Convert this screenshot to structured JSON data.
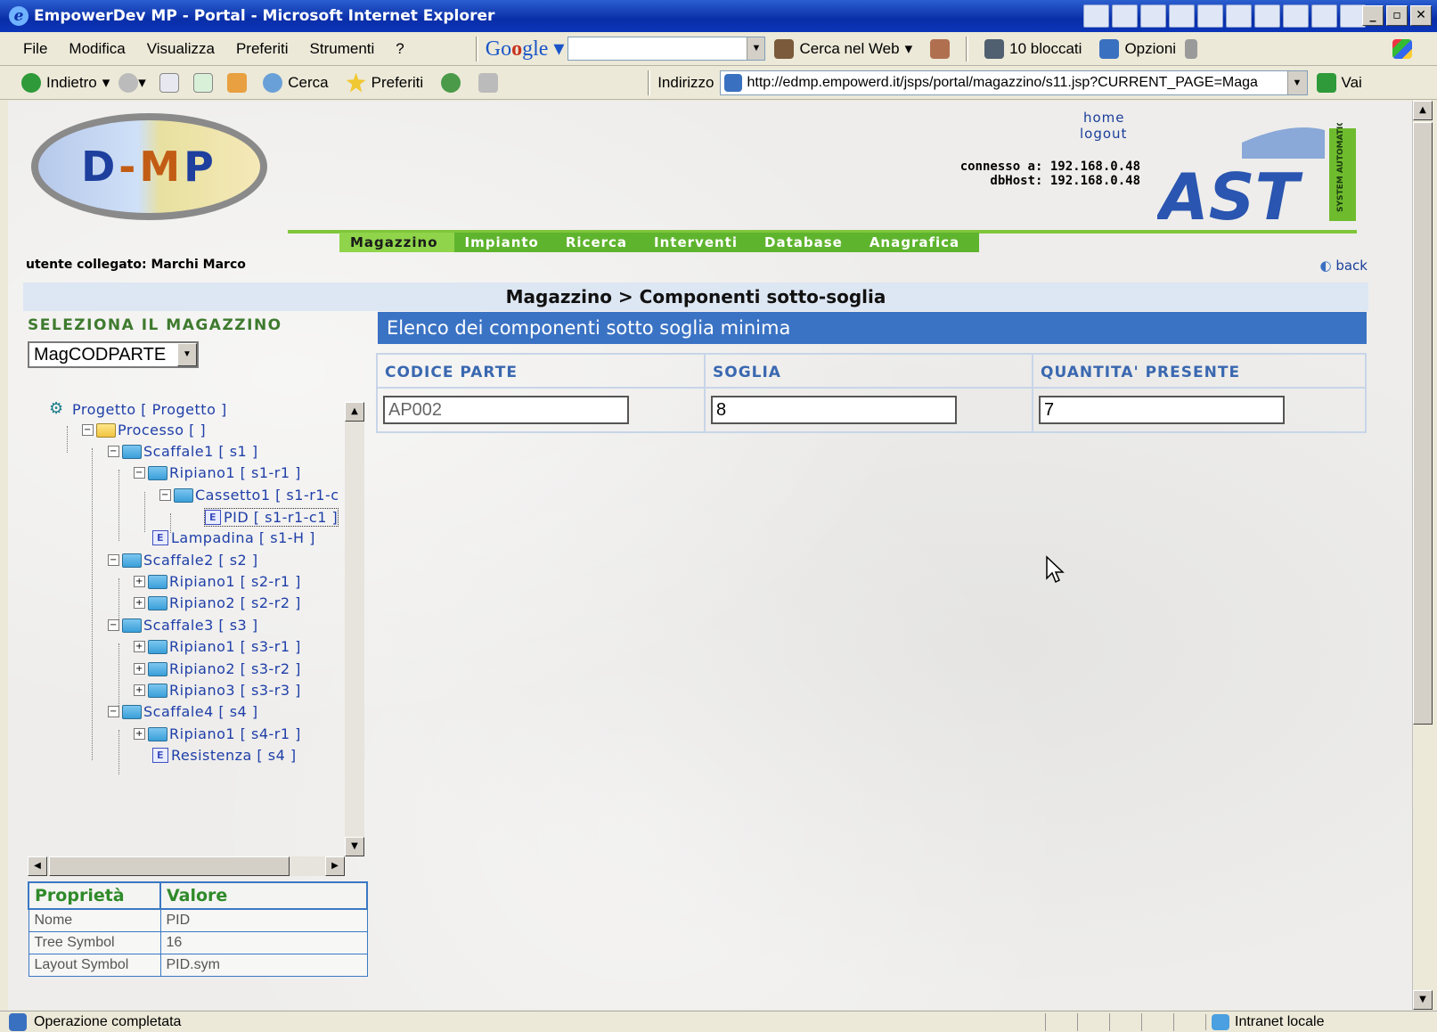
{
  "window": {
    "title": "EmpowerDev MP - Portal - Microsoft Internet Explorer"
  },
  "menubar": {
    "items": [
      "File",
      "Modifica",
      "Visualizza",
      "Preferiti",
      "Strumenti",
      "?"
    ],
    "search_web": "Cerca nel Web",
    "blocked": "10 bloccati",
    "options": "Opzioni"
  },
  "navbar": {
    "back": "Indietro",
    "search": "Cerca",
    "favorites": "Preferiti",
    "address_label": "Indirizzo",
    "url": "http://edmp.empowerd.it/jsps/portal/magazzino/s11.jsp?CURRENT_PAGE=Maga",
    "go": "Vai"
  },
  "header": {
    "logo_d": "D",
    "logo_dash": "-",
    "logo_m": "M",
    "logo_p": "P",
    "home": "home",
    "logout": "logout",
    "connected_to": "connesso a: 192.168.0.48",
    "db_host": "dbHost: 192.168.0.48",
    "brand": "AST",
    "brand_side": "SYSTEM AUTOMATION"
  },
  "mainnav": [
    "Magazzino",
    "Impianto",
    "Ricerca",
    "Interventi",
    "Database",
    "Anagrafica"
  ],
  "user": "utente collegato: Marchi Marco",
  "back": "back",
  "breadcrumb": "Magazzino > Componenti sotto-soglia",
  "sidebar": {
    "select_heading": "SELEZIONA IL MAGAZZINO",
    "selected_magazzino": "MagCODPARTE",
    "tree": [
      {
        "label": "Progetto [ Progetto ]"
      },
      {
        "label": "Processo [ ]"
      },
      {
        "label": "Scaffale1 [ s1 ]"
      },
      {
        "label": "Ripiano1 [ s1-r1 ]"
      },
      {
        "label": "Cassetto1 [ s1-r1-c"
      },
      {
        "label": "PID [ s1-r1-c1 ]"
      },
      {
        "label": "Lampadina [ s1-H ]"
      },
      {
        "label": "Scaffale2 [ s2 ]"
      },
      {
        "label": "Ripiano1 [ s2-r1 ]"
      },
      {
        "label": "Ripiano2 [ s2-r2 ]"
      },
      {
        "label": "Scaffale3 [ s3 ]"
      },
      {
        "label": "Ripiano1 [ s3-r1 ]"
      },
      {
        "label": "Ripiano2 [ s3-r2 ]"
      },
      {
        "label": "Ripiano3 [ s3-r3 ]"
      },
      {
        "label": "Scaffale4 [ s4 ]"
      },
      {
        "label": "Ripiano1 [ s4-r1 ]"
      },
      {
        "label": "Resistenza [ s4 ]"
      }
    ],
    "properties": {
      "headers": [
        "Proprietà",
        "Valore"
      ],
      "rows": [
        [
          "Nome",
          "PID"
        ],
        [
          "Tree Symbol",
          "16"
        ],
        [
          "Layout Symbol",
          "PID.sym"
        ]
      ]
    }
  },
  "main": {
    "list_title": "Elenco dei componenti sotto soglia minima",
    "columns": [
      "CODICE PARTE",
      "SOGLIA",
      "QUANTITA' PRESENTE"
    ],
    "row": {
      "codice": "AP002",
      "soglia": "8",
      "quantita": "7"
    }
  },
  "statusbar": {
    "text": "Operazione completata",
    "zone": "Intranet locale"
  }
}
